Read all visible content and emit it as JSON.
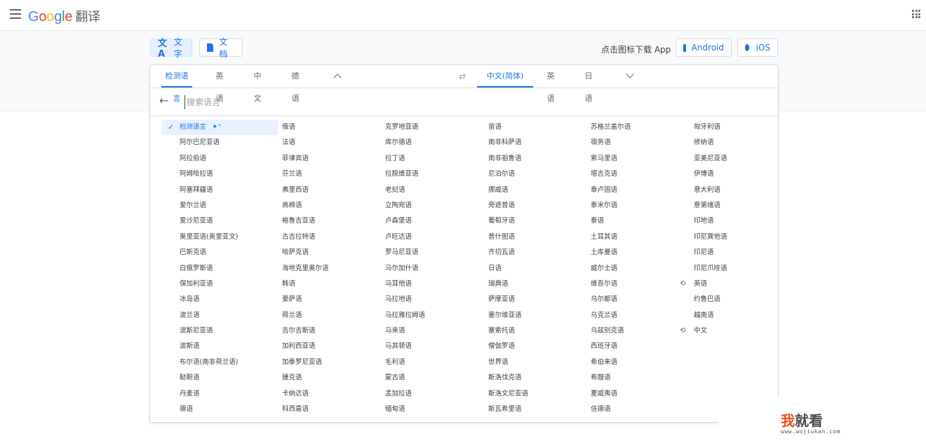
{
  "header": {
    "logo": {
      "G": "G",
      "o1": "o",
      "o2": "o",
      "g": "g",
      "l": "l",
      "e": "e"
    },
    "product": "翻译"
  },
  "modes": [
    {
      "label": "文字",
      "icon": "translate-icon"
    },
    {
      "label": "文档",
      "icon": "document-icon"
    }
  ],
  "download": {
    "text": "点击图标下载 App",
    "android": "Android",
    "ios": "iOS"
  },
  "source_tabs": [
    "检测语言",
    "英语",
    "中文",
    "德语"
  ],
  "target_tabs": [
    "中文(简体)",
    "英语",
    "日语"
  ],
  "search": {
    "placeholder": "搜索语言"
  },
  "languages": [
    [
      "检测语言",
      "阿尔巴尼亚语",
      "阿拉伯语",
      "阿姆哈拉语",
      "阿塞拜疆语",
      "爱尔兰语",
      "爱沙尼亚语",
      "奥里亚语(奥里亚文)",
      "巴斯克语",
      "白俄罗斯语",
      "保加利亚语",
      "冰岛语",
      "波兰语",
      "波斯尼亚语",
      "波斯语",
      "布尔语(南非荷兰语)",
      "鞑靼语",
      "丹麦语",
      "德语"
    ],
    [
      "俄语",
      "法语",
      "菲律宾语",
      "芬兰语",
      "弗里西语",
      "高棉语",
      "格鲁吉亚语",
      "古吉拉特语",
      "哈萨克语",
      "海地克里奥尔语",
      "韩语",
      "豪萨语",
      "荷兰语",
      "吉尔吉斯语",
      "加利西亚语",
      "加泰罗尼亚语",
      "捷克语",
      "卡纳达语",
      "科西嘉语"
    ],
    [
      "克罗地亚语",
      "库尔德语",
      "拉丁语",
      "拉脱维亚语",
      "老挝语",
      "立陶宛语",
      "卢森堡语",
      "卢旺达语",
      "罗马尼亚语",
      "马尔加什语",
      "马耳他语",
      "马拉地语",
      "马拉雅拉姆语",
      "马来语",
      "马其顿语",
      "毛利语",
      "蒙古语",
      "孟加拉语",
      "缅甸语"
    ],
    [
      "苗语",
      "南非科萨语",
      "南非祖鲁语",
      "尼泊尔语",
      "挪威语",
      "旁遮普语",
      "葡萄牙语",
      "普什图语",
      "齐切瓦语",
      "日语",
      "瑞典语",
      "萨摩亚语",
      "塞尔维亚语",
      "塞索托语",
      "僧伽罗语",
      "世界语",
      "斯洛伐克语",
      "斯洛文尼亚语",
      "斯瓦希里语"
    ],
    [
      "苏格兰盖尔语",
      "宿务语",
      "索马里语",
      "塔吉克语",
      "泰卢固语",
      "泰米尔语",
      "泰语",
      "土耳其语",
      "土库曼语",
      "威尔士语",
      "维吾尔语",
      "乌尔都语",
      "乌克兰语",
      "乌兹别克语",
      "西班牙语",
      "希伯来语",
      "希腊语",
      "夏威夷语",
      "信德语"
    ],
    [
      "匈牙利语",
      "修纳语",
      "亚美尼亚语",
      "伊博语",
      "意大利语",
      "意第绪语",
      "印地语",
      "印尼巽他语",
      "印尼语",
      "印尼爪哇语",
      "英语",
      "约鲁巴语",
      "越南语",
      "中文"
    ]
  ],
  "watermark": {
    "title_a": "我",
    "title_b": "就看",
    "url": "www.wojiukan.com"
  }
}
